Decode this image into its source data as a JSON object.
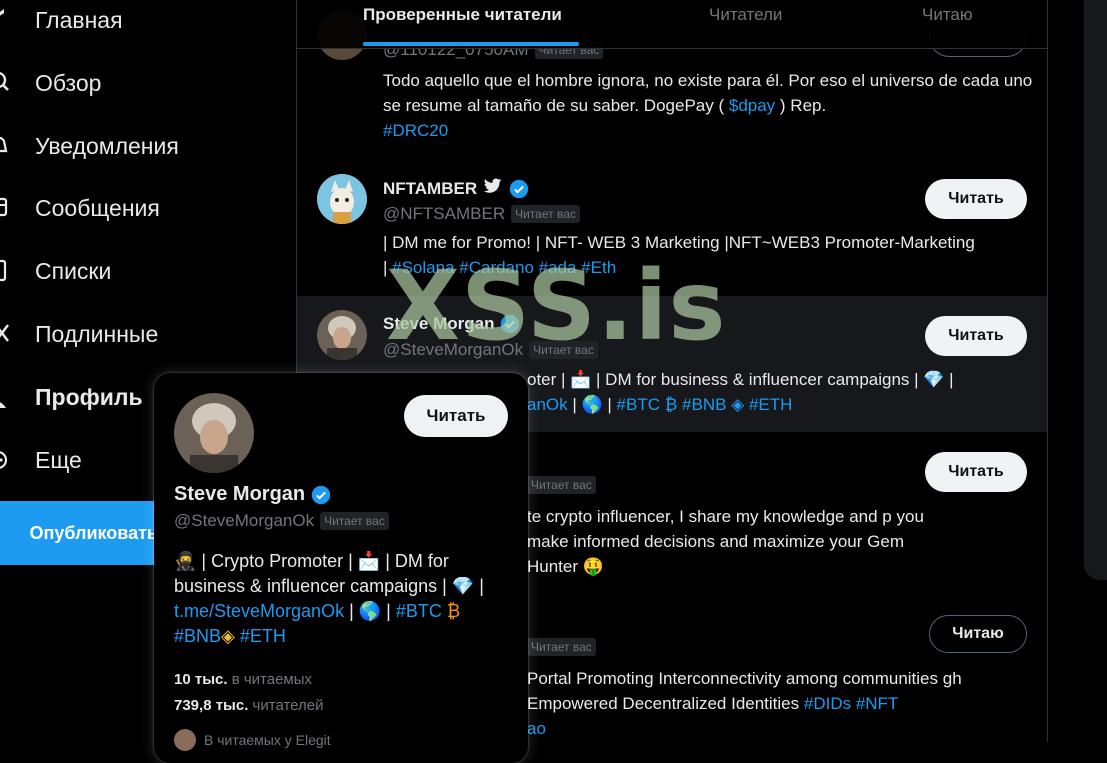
{
  "nav": {
    "items": [
      {
        "label": "Главная",
        "icon": "home-icon"
      },
      {
        "label": "Обзор",
        "icon": "explore-icon"
      },
      {
        "label": "Уведомления",
        "icon": "bell-icon"
      },
      {
        "label": "Сообщения",
        "icon": "mail-icon"
      },
      {
        "label": "Списки",
        "icon": "list-icon"
      },
      {
        "label": "Подлинные",
        "icon": "x-logo-icon"
      },
      {
        "label": "Профиль",
        "icon": "person-icon"
      },
      {
        "label": "Еще",
        "icon": "more-circle-icon"
      }
    ],
    "publish": "Опубликовать"
  },
  "tabs": {
    "verified": "Проверенные читатели",
    "followers": "Читатели",
    "following": "Читаю"
  },
  "badge_follows_you": "Читает вас",
  "rows": [
    {
      "handle": "@110122_0750AM",
      "bio_pre": "Todo aquello que el hombre ignora, no existe para él. Por eso el universo de cada uno se resume al tamaño de su saber. DogePay ( ",
      "bio_tag1": "$dpay",
      "bio_mid": " ) Rep. ",
      "bio_tag2": "#DRC20"
    },
    {
      "name": "NFTAMBER",
      "handle": "@NFTSAMBER",
      "button": "Читать",
      "bio_pre": "| DM me for Promo! | NFT- WEB 3 Marketing |NFT~WEB3 Promoter-Marketing | ",
      "tags": "#Solana #Cardano #ada #Eth"
    },
    {
      "name": "Steve Morgan",
      "handle": "@SteveMorganOk",
      "button": "Читать",
      "bio_pre": "oter | 📩 | DM for business & influencer campaigns | 💎 |",
      "bio_line2_link": "anOk",
      "bio_line2_rest": " | 🌎 | ",
      "bio_line2_tags": "#BTC ₿ #BNB ◈ #ETH"
    },
    {
      "button": "Читать",
      "bio": "te crypto influencer, I share my knowledge and p you make informed decisions and maximize your Gem Hunter 🤑"
    },
    {
      "button": "Читаю",
      "bio_pre": "Portal Promoting Interconnectivity among communities gh Empowered Decentralized Identities ",
      "tags": "#DIDs #NFT",
      "bio_tail": "ao"
    }
  ],
  "watermark": "XSS.is",
  "hovercard": {
    "name": "Steve Morgan",
    "handle": "@SteveMorganOk",
    "button": "Читать",
    "bio_line1": "🥷 | Crypto Promoter | 📩 | DM for",
    "bio_line2": "business & influencer campaigns | 💎 |",
    "link": "t.me/SteveMorganOk",
    "tag_btc": "#BTC",
    "tag_bnb": "#BNB",
    "tag_eth": "#ETH",
    "following_count": "10 тыс.",
    "following_label": "в читаемых",
    "followers_count": "739,8 тыс.",
    "followers_label": "читателей",
    "mutual": "В читаемых у Elegit"
  },
  "colors": {
    "accent": "#1d9bf0",
    "background": "#000000",
    "muted": "#71767b"
  }
}
